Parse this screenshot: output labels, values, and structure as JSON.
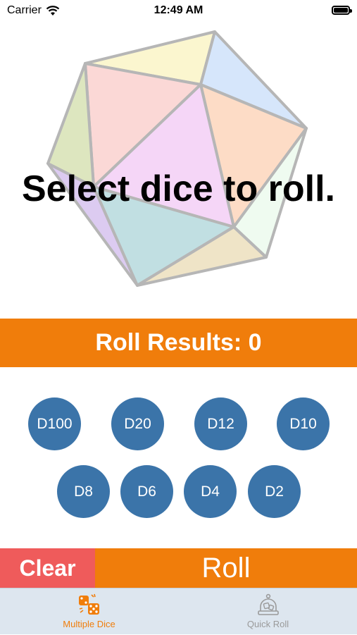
{
  "status_bar": {
    "carrier": "Carrier",
    "time": "12:49 AM"
  },
  "main": {
    "prompt": "Select dice to roll."
  },
  "results": {
    "label": "Roll Results: 0"
  },
  "dice": [
    {
      "label": "D100"
    },
    {
      "label": "D20"
    },
    {
      "label": "D12"
    },
    {
      "label": "D10"
    },
    {
      "label": "D8"
    },
    {
      "label": "D6"
    },
    {
      "label": "D4"
    },
    {
      "label": "D2"
    }
  ],
  "actions": {
    "clear_label": "Clear",
    "roll_label": "Roll"
  },
  "tabs": [
    {
      "label": "Multiple Dice",
      "icon": "dice-icon",
      "active": true
    },
    {
      "label": "Quick Roll",
      "icon": "dice-cup-icon",
      "active": false
    }
  ],
  "colors": {
    "accent": "#f07d0b",
    "clear": "#ef5b5b",
    "dice_button": "#3b74a9",
    "tab_bar": "#dde6ef",
    "tab_inactive": "#9a9a9a"
  }
}
